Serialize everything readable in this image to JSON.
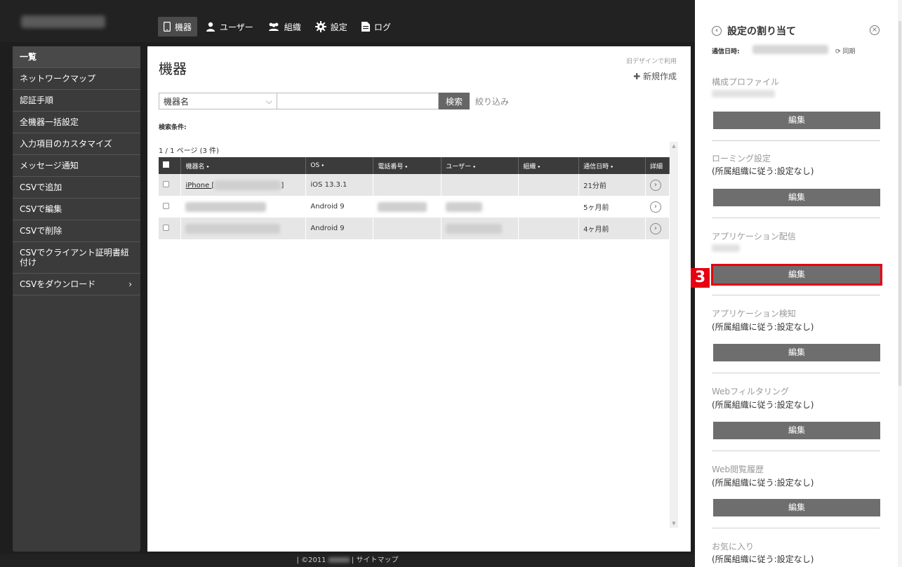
{
  "nav": {
    "items": [
      {
        "label": "機器",
        "icon": "device-icon",
        "active": true
      },
      {
        "label": "ユーザー",
        "icon": "user-icon"
      },
      {
        "label": "組織",
        "icon": "group-icon"
      },
      {
        "label": "設定",
        "icon": "gear-icon"
      },
      {
        "label": "ログ",
        "icon": "document-icon"
      }
    ]
  },
  "sidebar": {
    "items": [
      {
        "label": "一覧"
      },
      {
        "label": "ネットワークマップ"
      },
      {
        "label": "認証手順"
      },
      {
        "label": "全機器一括設定"
      },
      {
        "label": "入力項目のカスタマイズ"
      },
      {
        "label": "メッセージ通知"
      },
      {
        "label": "CSVで追加"
      },
      {
        "label": "CSVで編集"
      },
      {
        "label": "CSVで削除"
      },
      {
        "label": "CSVでクライアント証明書紐付け"
      },
      {
        "label": "CSVをダウンロード"
      }
    ]
  },
  "main": {
    "title": "機器",
    "old_design": "旧デザインで利用",
    "new_create": "✚ 新規作成",
    "search": {
      "select_value": "機器名",
      "button": "検索",
      "filter": "絞り込み"
    },
    "conditions_label": "検索条件:",
    "pager": "1 / 1 ページ (3 件)",
    "columns": [
      "機器名 ⬩",
      "OS ⬩",
      "電話番号 ⬩",
      "ユーザー ⬩",
      "組織 ⬩",
      "通信日時 ⬩",
      "詳細"
    ],
    "rows": [
      {
        "name_prefix": "iPhone [",
        "name_suffix": "]",
        "os": "iOS 13.3.1",
        "time": "21分前"
      },
      {
        "os": "Android 9",
        "time": "5ヶ月前"
      },
      {
        "os": "Android 9",
        "time": "4ヶ月前"
      }
    ]
  },
  "footer": {
    "copyright": "| ©2011",
    "sitemap": "| サイトマップ"
  },
  "panel": {
    "title": "設定の割り当て",
    "sync_label": "通信日時:",
    "sync_button": "⟳ 同期",
    "edit_label": "編集",
    "sections": [
      {
        "title": "構成プロファイル"
      },
      {
        "title": "ローミング設定",
        "note": "(所属組織に従う:設定なし)"
      },
      {
        "title": "アプリケーション配信"
      },
      {
        "title": "アプリケーション検知",
        "note": "(所属組織に従う:設定なし)"
      },
      {
        "title": "Webフィルタリング",
        "note": "(所属組織に従う:設定なし)"
      },
      {
        "title": "Web閲覧履歴",
        "note": "(所属組織に従う:設定なし)"
      },
      {
        "title": "お気に入り",
        "note": "(所属組織に従う:設定なし)"
      }
    ],
    "step_badge": "3"
  }
}
